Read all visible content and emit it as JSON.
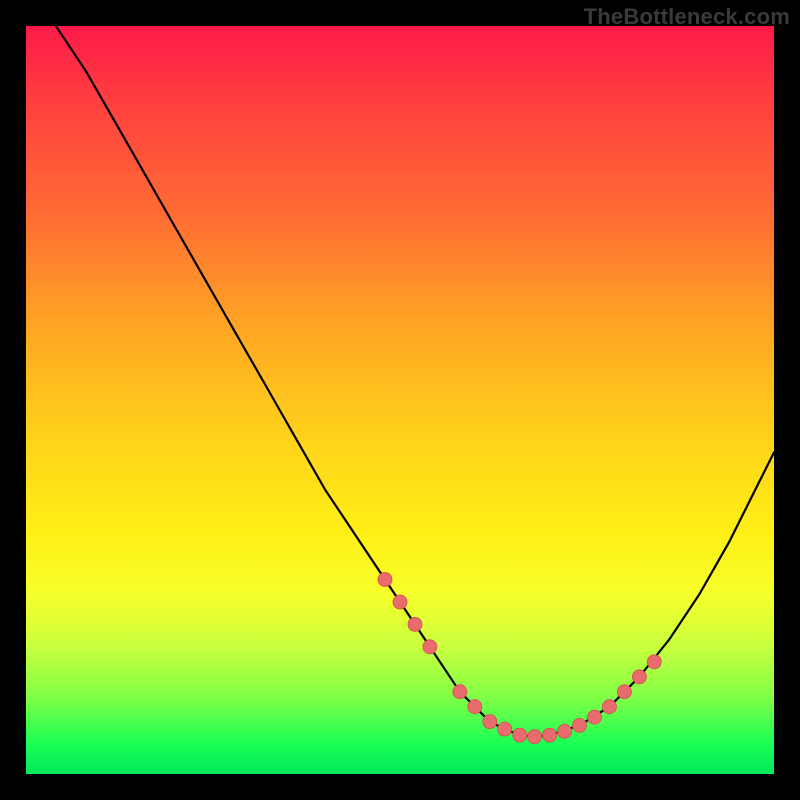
{
  "watermark": "TheBottleneck.com",
  "colors": {
    "background": "#000000",
    "gradient_top": "#ff1a49",
    "gradient_mid": "#fff016",
    "gradient_bottom": "#00e85a",
    "curve": "#000000",
    "marker_fill": "#e86b6d",
    "marker_stroke": "#d94a4e"
  },
  "chart_data": {
    "type": "line",
    "title": "",
    "xlabel": "",
    "ylabel": "",
    "xlim": [
      0,
      100
    ],
    "ylim": [
      0,
      100
    ],
    "grid": false,
    "series": [
      {
        "name": "curve",
        "x": [
          4,
          8,
          12,
          16,
          20,
          24,
          28,
          32,
          36,
          40,
          44,
          48,
          52,
          56,
          58,
          60,
          62,
          64,
          66,
          68,
          70,
          74,
          78,
          82,
          86,
          90,
          94,
          98,
          100
        ],
        "y": [
          100,
          94,
          87,
          80,
          73,
          66,
          59,
          52,
          45,
          38,
          32,
          26,
          20,
          14,
          11,
          9,
          7,
          6,
          5.2,
          5,
          5.2,
          6.5,
          9,
          13,
          18,
          24,
          31,
          39,
          43
        ]
      }
    ],
    "markers": {
      "name": "highlight-points",
      "x": [
        48,
        50,
        52,
        54,
        58,
        60,
        62,
        64,
        66,
        68,
        70,
        72,
        74,
        76,
        78,
        80,
        82,
        84
      ],
      "y": [
        26,
        23,
        20,
        17,
        11,
        9,
        7,
        6,
        5.2,
        5,
        5.2,
        5.7,
        6.5,
        7.6,
        9,
        11,
        13,
        15
      ]
    }
  }
}
